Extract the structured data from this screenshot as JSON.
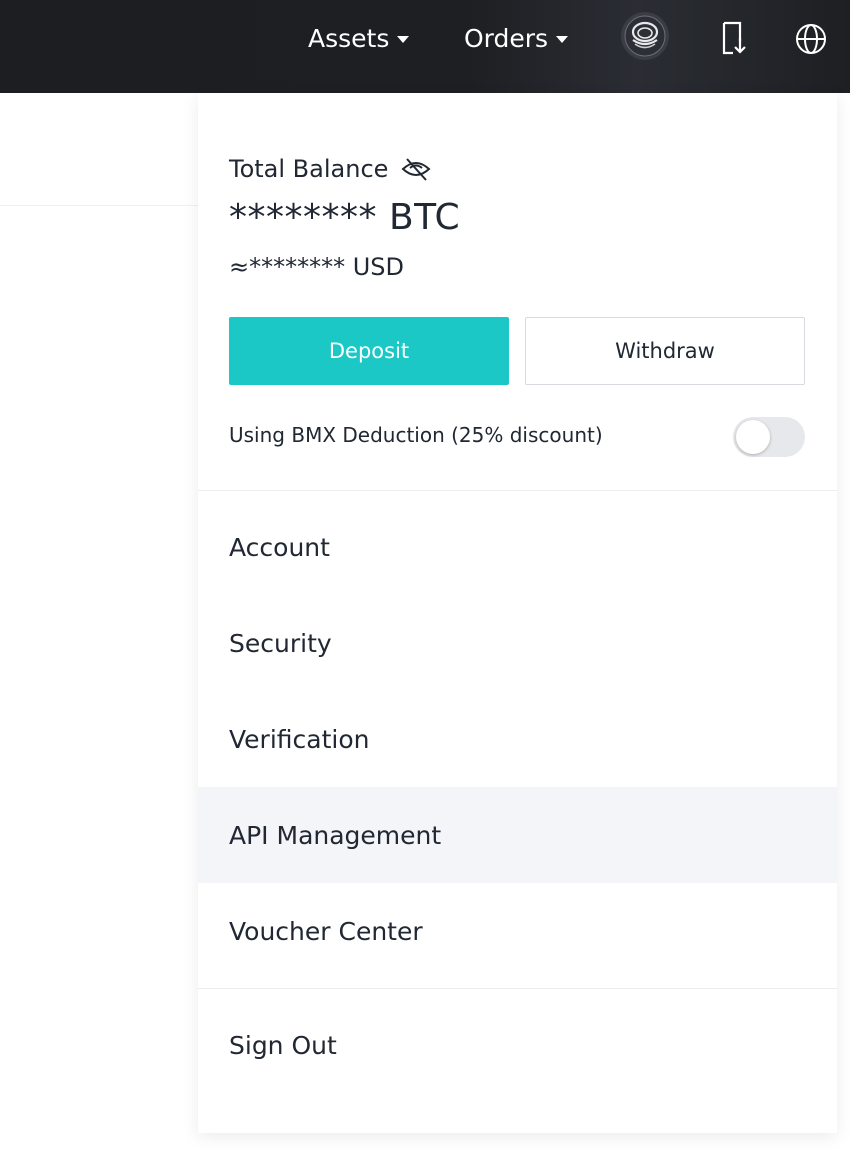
{
  "header": {
    "assets_label": "Assets",
    "orders_label": "Orders",
    "icons": [
      "avatar-icon",
      "download-app-icon",
      "globe-icon"
    ]
  },
  "dropdown": {
    "balance": {
      "label": "Total Balance",
      "btc": "******** BTC",
      "usd": "≈******** USD"
    },
    "buttons": {
      "deposit": "Deposit",
      "withdraw": "Withdraw"
    },
    "deduction": {
      "label": "Using BMX Deduction (25% discount)",
      "enabled": false
    },
    "menu": [
      {
        "label": "Account"
      },
      {
        "label": "Security"
      },
      {
        "label": "Verification"
      },
      {
        "label": "API Management",
        "highlighted": true
      },
      {
        "label": "Voucher Center"
      }
    ],
    "sign_out": "Sign Out"
  },
  "colors": {
    "topbar": "#1d1f23",
    "accent": "#1bc8c5",
    "text": "#212833",
    "hover": "#f3f5f8"
  }
}
